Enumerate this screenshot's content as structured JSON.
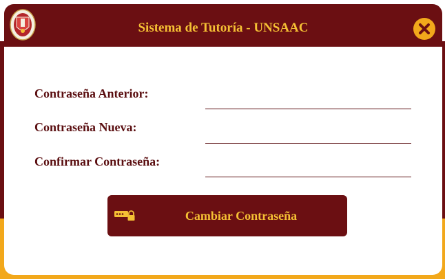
{
  "window": {
    "title": "Sistema de Tutoría - UNSAAC",
    "logo_icon": "unsaac-shield-icon",
    "close_icon": "close-circle-icon"
  },
  "form": {
    "fields": [
      {
        "label": "Contraseña Anterior:",
        "value": "",
        "placeholder": ""
      },
      {
        "label": "Contraseña Nueva:",
        "value": "",
        "placeholder": ""
      },
      {
        "label": "Confirmar Contraseña:",
        "value": "",
        "placeholder": ""
      }
    ]
  },
  "submit": {
    "label": "Cambiar Contraseña",
    "icon": "password-lock-icon"
  },
  "colors": {
    "primary": "#6b0f12",
    "accent": "#f5c034",
    "orange": "#f2a81b",
    "background": "#ffffff"
  }
}
